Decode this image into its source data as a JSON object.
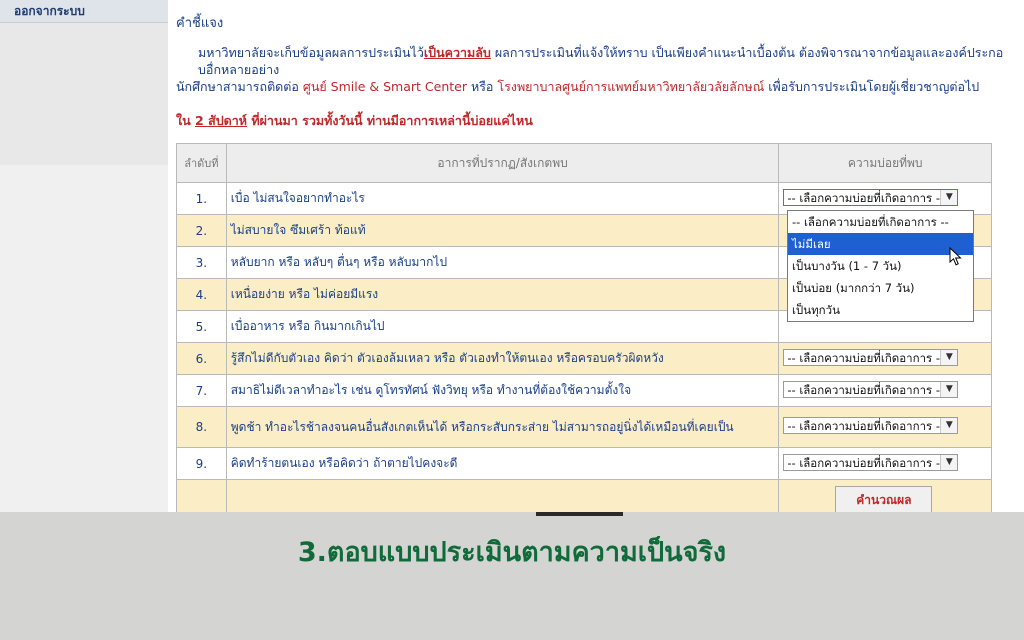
{
  "sidebar": {
    "logout_label": "ออกจากระบบ"
  },
  "main": {
    "title": "คำชี้แจง",
    "intro_part1": "มหาวิทยาลัยจะเก็บข้อมูลผลการประเมินไว้",
    "intro_secret": "เป็นความลับ",
    "intro_part2": " ผลการประเมินที่แจ้งให้ทราบ เป็นเพียงคำแนะนำเบื้องต้น ต้องพิจารณาจากข้อมูลและองค์ประกอบอื่กหลายอย่าง",
    "contact_part1": "นักศึกษาสามารถติดต่อ ",
    "contact_center": "ศูนย์ Smile & Smart Center",
    "contact_part2": " หรือ ",
    "contact_hospital": "โรงพยาบาลศูนย์การแพทย์มหาวิทยาลัยวลัยลักษณ์",
    "contact_part3": " เพื่อรับการประเมินโดยผู้เชี่ยวชาญต่อไป",
    "question_part1": "ใน ",
    "question_weeks": "2 สัปดาห์",
    "question_part2": " ที่ผ่านมา รวมทั้งวันนี้ ท่านมีอาการเหล่านี้บ่อยแค่ไหน"
  },
  "table": {
    "headers": {
      "num": "ลำดับที่",
      "symptom": "อาการที่ปรากฏ/สังเกตพบ",
      "frequency": "ความบ่อยที่พบ"
    },
    "select_placeholder": "-- เลือกความบ่อยที่เกิดอาการ --",
    "rows": [
      {
        "num": "1.",
        "symptom": "เบื่อ ไม่สนใจอยากทำอะไร"
      },
      {
        "num": "2.",
        "symptom": "ไม่สบายใจ ซึมเศร้า ท้อแท้"
      },
      {
        "num": "3.",
        "symptom": "หลับยาก หรือ หลับๆ ตื่นๆ หรือ หลับมากไป"
      },
      {
        "num": "4.",
        "symptom": "เหนื่อยง่าย หรือ ไม่ค่อยมีแรง"
      },
      {
        "num": "5.",
        "symptom": "เบื่ออาหาร หรือ กินมากเกินไป"
      },
      {
        "num": "6.",
        "symptom": "รู้สึกไม่ดีกับตัวเอง คิดว่า ตัวเองล้มเหลว หรือ ตัวเองทำให้ตนเอง หรือครอบครัวผิดหวัง"
      },
      {
        "num": "7.",
        "symptom": "สมาธิไม่ดีเวลาทำอะไร เช่น ดูโทรทัศน์ ฟังวิทยุ หรือ ทำงานที่ต้องใช้ความตั้งใจ"
      },
      {
        "num": "8.",
        "symptom": "พูดช้า ทำอะไรช้าลงจนคนอื่นสังเกตเห็นได้ หรือกระสับกระส่าย ไม่สามารถอยู่นิ่งได้เหมือนที่เคยเป็น"
      },
      {
        "num": "9.",
        "symptom": "คิดทำร้ายตนเอง หรือคิดว่า ถ้าตายไปคงจะดี"
      }
    ],
    "calculate_label": "คำนวณผล"
  },
  "dropdown": {
    "options": [
      "-- เลือกความบ่อยที่เกิดอาการ --",
      "ไม่มีเลย",
      "เป็นบางวัน (1 - 7 วัน)",
      "เป็นบ่อย (มากกว่า 7 วัน)",
      "เป็นทุกวัน"
    ],
    "highlighted_index": 1
  },
  "caption": "3.ตอบแบบประเมินตามความเป็นจริง"
}
